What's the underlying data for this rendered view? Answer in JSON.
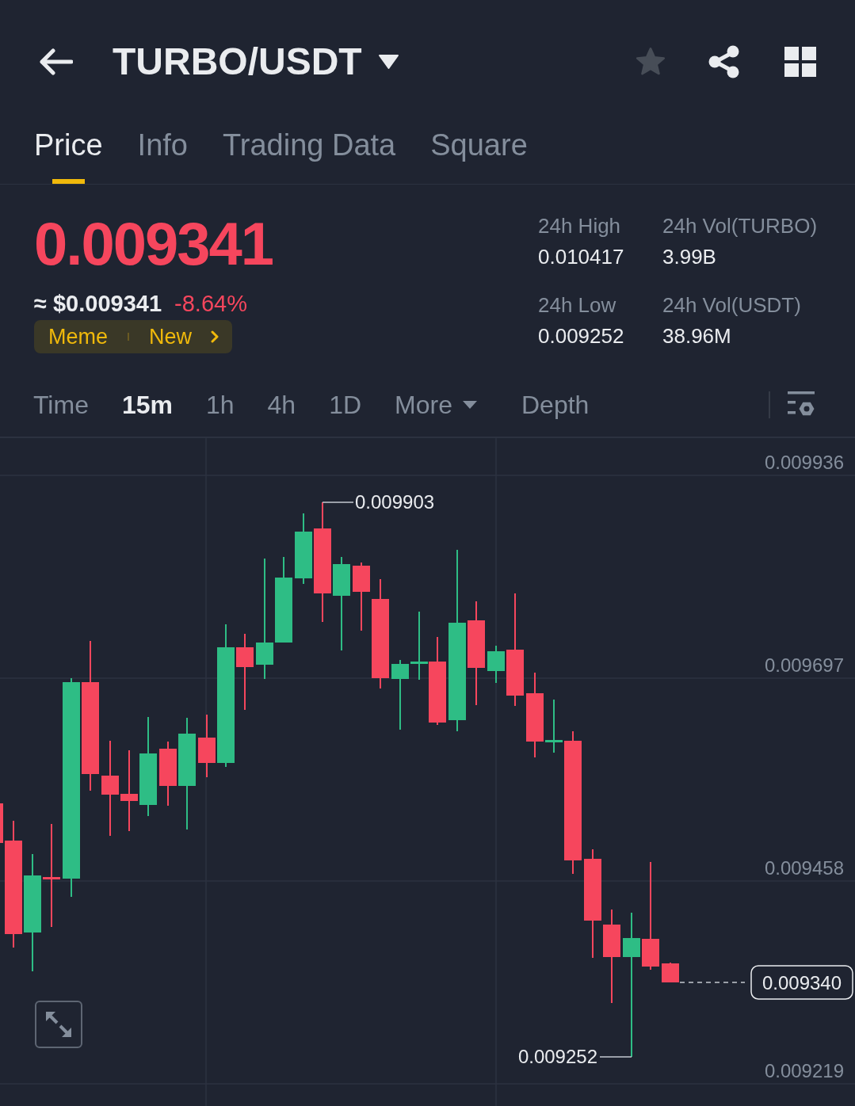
{
  "header": {
    "title": "TURBO/USDT",
    "favorited": false
  },
  "tabs": [
    {
      "label": "Price",
      "selected": true
    },
    {
      "label": "Info",
      "selected": false
    },
    {
      "label": "Trading Data",
      "selected": false
    },
    {
      "label": "Square",
      "selected": false
    }
  ],
  "price": {
    "last": "0.009341",
    "fiat": "≈ $0.009341",
    "change": "-8.64%",
    "rising": false
  },
  "tags": [
    "Meme",
    "New"
  ],
  "stats": [
    {
      "label": "24h High",
      "value": "0.010417"
    },
    {
      "label": "24h Vol(TURBO)",
      "value": "3.99B"
    },
    {
      "label": "24h Low",
      "value": "0.009252"
    },
    {
      "label": "24h Vol(USDT)",
      "value": "38.96M"
    }
  ],
  "intervals": [
    {
      "label": "Time",
      "kind": "interval",
      "selected": false
    },
    {
      "label": "15m",
      "kind": "interval",
      "selected": true
    },
    {
      "label": "1h",
      "kind": "interval",
      "selected": false
    },
    {
      "label": "4h",
      "kind": "interval",
      "selected": false
    },
    {
      "label": "1D",
      "kind": "interval",
      "selected": false
    },
    {
      "label": "More",
      "kind": "dropdown",
      "selected": false
    },
    {
      "label": "Depth",
      "kind": "interval",
      "selected": false
    }
  ],
  "chart": {
    "price_scale": [
      "0.009936",
      "0.009697",
      "0.009458",
      "0.009219"
    ],
    "high_marker": "0.009903",
    "low_marker": "0.009252",
    "last_price": "0.009340"
  }
}
